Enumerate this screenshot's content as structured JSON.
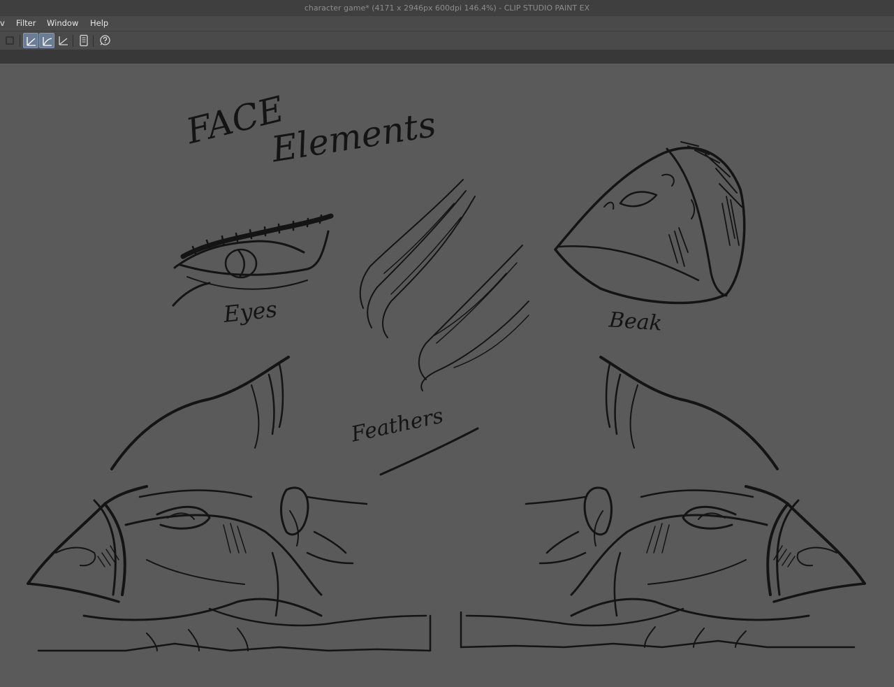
{
  "window": {
    "title": "character game* (4171 x 2946px 600dpi 146.4%)  - CLIP STUDIO PAINT EX"
  },
  "menu": {
    "items": [
      {
        "label": "v"
      },
      {
        "label": "Filter"
      },
      {
        "label": "Window"
      },
      {
        "label": "Help"
      }
    ]
  },
  "toolbar": {
    "buttons": [
      {
        "icon": "select-square-icon",
        "active": false
      },
      {
        "icon": "stabilization-line-icon",
        "active": true
      },
      {
        "icon": "stabilization-curve-icon",
        "active": true
      },
      {
        "icon": "ruler-line-icon",
        "active": false
      },
      {
        "icon": "tablet-icon",
        "active": false
      },
      {
        "icon": "help-icon",
        "active": false
      }
    ]
  },
  "canvas": {
    "labels": {
      "title_line1": "FACE",
      "title_line2": "Elements",
      "eyes": "Eyes",
      "beak": "Beak",
      "feathers": "Feathers"
    }
  },
  "colors": {
    "ink": "#141414",
    "canvas": "#5a5a5a",
    "titlebar": "#3f3f3f",
    "menubar": "#4a4a4a",
    "active_button": "#6b7d95"
  }
}
